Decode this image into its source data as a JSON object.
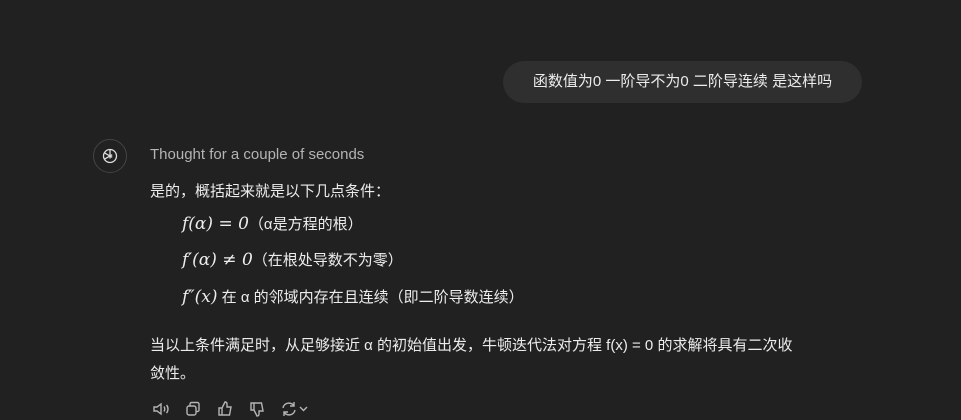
{
  "user_message": "函数值为0 一阶导不为0 二阶导连续 是这样吗",
  "assistant": {
    "thought": "Thought for a couple of seconds",
    "intro": "是的，概括起来就是以下几点条件：",
    "conditions": [
      {
        "math": "f(α) = 0",
        "note": "（α是方程的根）"
      },
      {
        "math": "f′(α) ≠ 0",
        "note": "（在根处导数不为零）"
      },
      {
        "math": "f″(x)",
        "note": " 在 α 的邻域内存在且连续（即二阶导数连续）"
      }
    ],
    "conclusion_1": "当以上条件满足时，从足够接近 α 的初始值出发，牛顿迭代法对方程 f(x) = 0 的求解将具有二次收",
    "conclusion_2": "敛性。"
  }
}
